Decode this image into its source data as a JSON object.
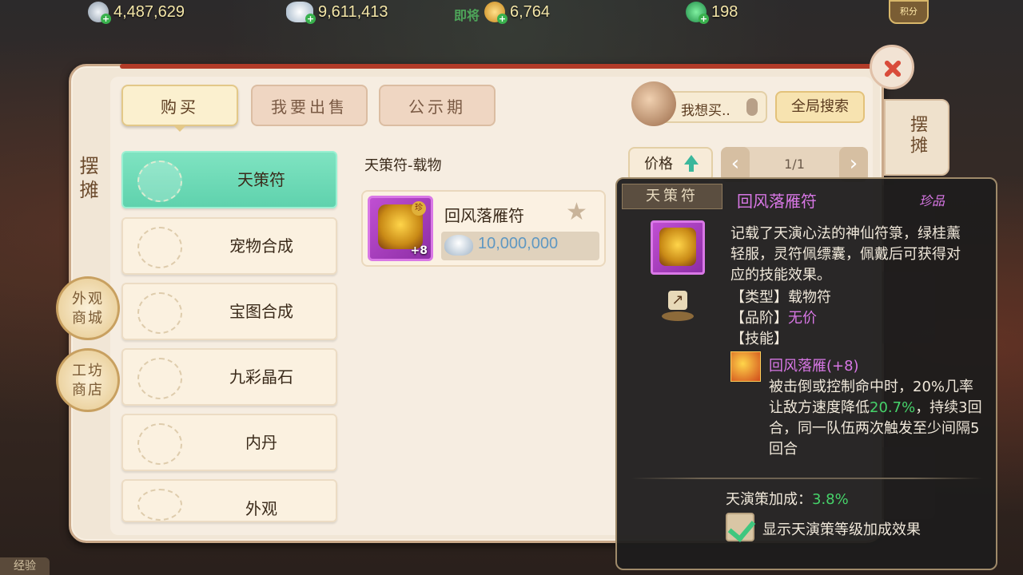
{
  "currencies": [
    {
      "name": "silver-icon",
      "value": "4,487,629",
      "color": "#c8d0d8"
    },
    {
      "name": "ingot-icon",
      "value": "9,611,413",
      "color": "#d0dde8"
    },
    {
      "name": "copper-coin-icon",
      "value": "6,764",
      "color": "#e8b040"
    },
    {
      "name": "jade-icon",
      "value": "198",
      "color": "#3fb56a"
    }
  ],
  "currency_overlay_text": "即将",
  "jifen_label": "积分",
  "side_tab_label": "摆摊",
  "tabs": [
    {
      "label": "购买",
      "active": true
    },
    {
      "label": "我要出售",
      "active": false
    },
    {
      "label": "公示期",
      "active": false
    }
  ],
  "want_buy": {
    "label": "我想买.."
  },
  "global_search": {
    "label": "全局搜索"
  },
  "categories": [
    {
      "label": "天策符",
      "active": true
    },
    {
      "label": "宠物合成",
      "active": false
    },
    {
      "label": "宝图合成",
      "active": false
    },
    {
      "label": "九彩晶石",
      "active": false
    },
    {
      "label": "内丹",
      "active": false
    },
    {
      "label": "外观",
      "active": false
    }
  ],
  "breadcrumb": "天策符-载物",
  "sort": {
    "label": "价格"
  },
  "pager": {
    "text": "1/1",
    "prev": "‹",
    "next": "›"
  },
  "item": {
    "name": "回风落雁符",
    "level": "+8",
    "gem_text": "珍",
    "price": "10,000,000",
    "star": "★"
  },
  "side_circles": [
    {
      "label": "外观商城"
    },
    {
      "label": "工坊商店"
    }
  ],
  "right_tab_label": "摆摊",
  "tooltip": {
    "tag": "天策符",
    "title": "回风落雁符",
    "rarity": "珍品",
    "description": "记载了天演心法的神仙符箓，绿桂薰轻服，灵符佩缥囊，佩戴后可获得对应的技能效果。",
    "type_label": "【类型】",
    "type_value": "载物符",
    "grade_label": "【品阶】",
    "grade_value": "无价",
    "skill_label": "【技能】",
    "skill_name": "回风落雁(+8)",
    "skill_desc_a": "被击倒或控制命中时，20%几率让敌方速度降低",
    "skill_desc_highlight": "20.7%",
    "skill_desc_b": "，持续3回合，同一队伍两次触发至少间隔5回合",
    "bonus_label": "天演策加成：",
    "bonus_value": "3.8%",
    "checkbox_label": "显示天演策等级加成效果",
    "checkbox_checked": true
  },
  "exp_label": "经验"
}
